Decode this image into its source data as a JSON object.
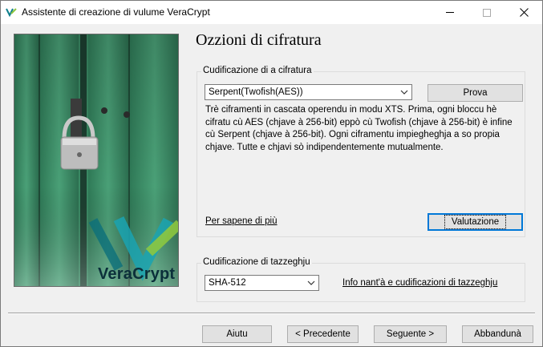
{
  "window": {
    "title": "Assistente di creazione di vulume VeraCrypt",
    "minimize": "—",
    "maximize": "☐",
    "close": "✕"
  },
  "banner": {
    "logo_text": "VeraCrypt",
    "logo_colors": {
      "teal": "#0f9aa6",
      "dark_teal": "#0b6f7a",
      "lime": "#8dc63f"
    }
  },
  "page": {
    "heading": "Ozzioni di cifratura"
  },
  "encryption": {
    "group_label": "Cudificazione di a cifratura",
    "selected_algorithm": "Serpent(Twofish(AES))",
    "test_button": "Prova",
    "description": "Trè ciframenti in cascata operendu in modu XTS. Prima, ogni bloccu hè cifratu cù AES (chjave à 256-bit) eppò cù Twofish (chjave à 256-bit) è infine cù Serpent (chjave à 256-bit). Ogni ciframentu impiegheghja a so propia chjave. Tutte e chjavi sò indipendentemente mutualmente.",
    "learn_more_link": "Per sapene di più",
    "benchmark_button": "Valutazione"
  },
  "hash": {
    "group_label": "Cudificazione di tazzeghju",
    "selected_hash": "SHA-512",
    "info_link": "Info nant'à e cudificazioni di tazzeghju"
  },
  "footer": {
    "help_button": "Aiutu",
    "prev_button": "< Precedente",
    "next_button": "Seguente >",
    "cancel_button": "Abbandunà"
  },
  "colors": {
    "window_bg": "#f0f0f0",
    "focus_blue": "#0078d7",
    "door_green": "#3f8f6a"
  }
}
